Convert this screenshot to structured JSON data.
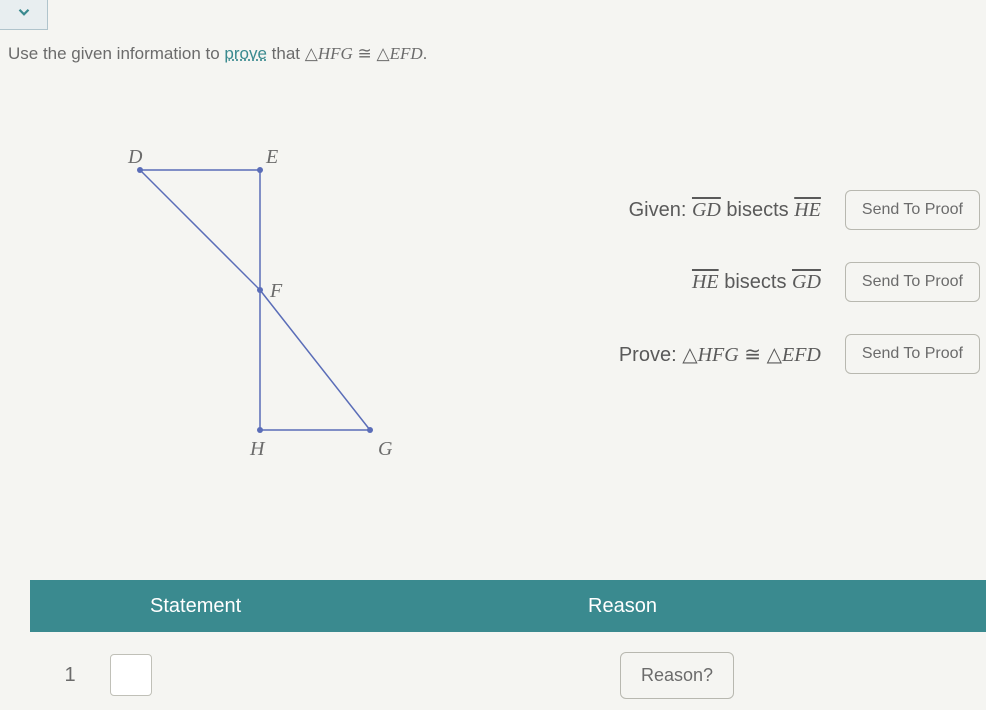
{
  "instruction": {
    "prefix": "Use the given information to ",
    "prove_word": "prove",
    "suffix": " that ",
    "lhs": "HFG",
    "rhs": "EFD"
  },
  "diagram": {
    "labels": {
      "D": "D",
      "E": "E",
      "F": "F",
      "H": "H",
      "G": "G"
    }
  },
  "givens": [
    {
      "label": "Given:",
      "seg1": "GD",
      "mid": " bisects ",
      "seg2": "HE"
    },
    {
      "label": "",
      "seg1": "HE",
      "mid": " bisects ",
      "seg2": "GD"
    }
  ],
  "prove": {
    "label": "Prove:",
    "lhs": "HFG",
    "rhs": "EFD"
  },
  "buttons": {
    "send": "Send To Proof",
    "reason": "Reason?"
  },
  "table": {
    "col1": "Statement",
    "col2": "Reason",
    "row1_num": "1"
  }
}
